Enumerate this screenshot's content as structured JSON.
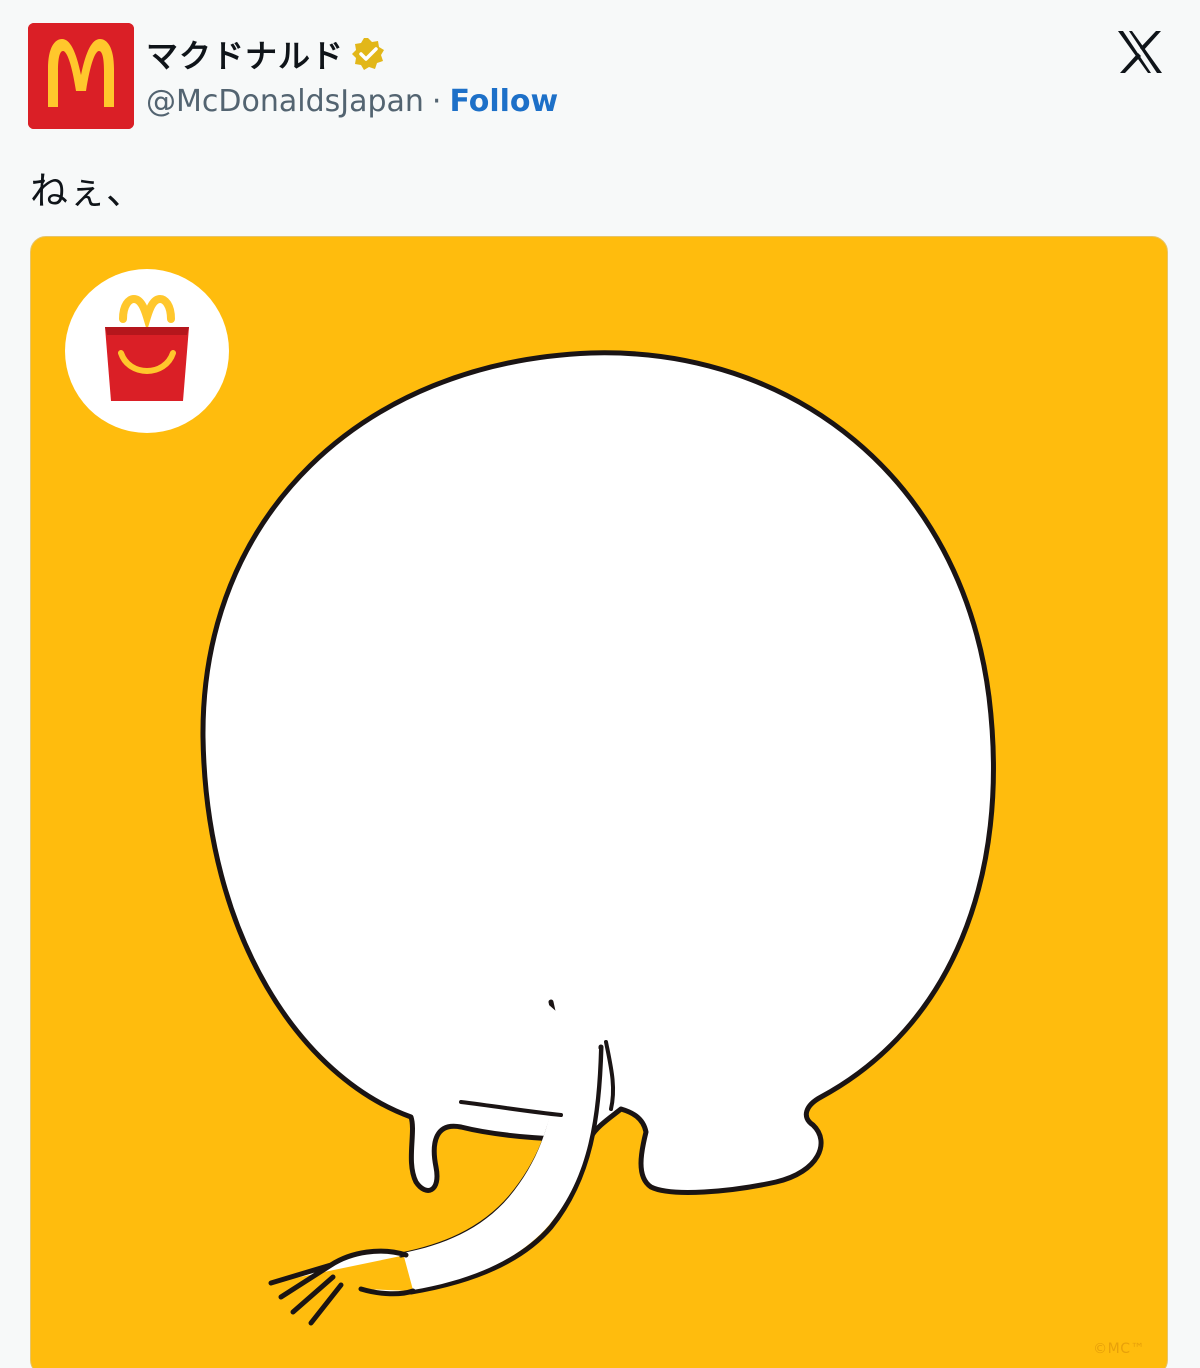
{
  "account": {
    "display_name": "マクドナルド",
    "handle": "@McDonaldsJapan",
    "separator": "·",
    "follow_label": "Follow",
    "avatar_icon": "mcdonalds-arches-logo",
    "verified_icon": "gold-verified-badge-icon"
  },
  "platform": {
    "logo_icon": "x-logo-icon"
  },
  "tweet": {
    "text": "ねぇ、"
  },
  "media": {
    "background_color": "#ffbc0d",
    "badge_icon": "happy-meal-box-icon",
    "illustration": "white-character-from-behind-holding-fork",
    "copyright": "©MC™"
  },
  "colors": {
    "brand_red": "#da1f26",
    "brand_yellow": "#ffbc0d",
    "follow_blue": "#1d70c8",
    "verified_gold": "#e2b719"
  }
}
